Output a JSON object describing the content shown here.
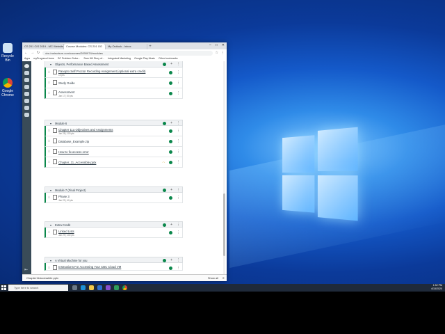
{
  "browser": {
    "tabs": [
      {
        "label": "CS 201 CIS 2019 - MC Website"
      },
      {
        "label": "Course Modules: CS 201 OO"
      },
      {
        "label": "My Outlook - Inbox"
      }
    ],
    "url": "cbc.instructure.com/courses/2090974/modules",
    "bookmarks": [
      "Apps",
      "myProgress Home",
      "SC Problem Solve...",
      "Sam Hill Story of...",
      "Integrated Marketing",
      "Google Play Music",
      "Other bookmarks"
    ],
    "download_file": "Chapter11Accessible.pptx",
    "show_all": "Show all"
  },
  "modules": [
    {
      "title": "Objects, Performance Based Assessment",
      "items": [
        {
          "name": "Panopto Self Proctor Recording Assignment (optional extra credit)",
          "meta": "10 pts",
          "underline": true
        },
        {
          "name": "Study Guide",
          "meta": "",
          "underline": false
        },
        {
          "name": "Assessment",
          "meta": "Jan 17  |  50 pts",
          "underline": false
        }
      ]
    },
    {
      "title": "Module 6",
      "items": [
        {
          "name": "Chapter 11a Objectives and Assignments",
          "meta": "Jan 28  |  100 pts",
          "underline": true
        },
        {
          "name": "Database_Example.zip",
          "meta": "",
          "underline": false
        },
        {
          "name": "How to fix access error",
          "meta": "",
          "underline": true
        },
        {
          "name": "Chapter_11_Accessible.pptx",
          "meta": "",
          "underline": true
        }
      ]
    },
    {
      "title": "Module 7 (Final Project)",
      "items": [
        {
          "name": "Phase 3",
          "meta": "Jan 29  |  40 pts",
          "underline": false
        }
      ]
    },
    {
      "title": "Extra Credit",
      "items": [
        {
          "name": "Linked Lists",
          "meta": "Jan 29  |  100 pts",
          "underline": true
        }
      ]
    },
    {
      "title": "A Virtual Machine for you",
      "items": [
        {
          "name": "Instructions For Accessing Your CBC Cloud VM",
          "meta": "",
          "underline": true
        }
      ]
    }
  ],
  "taskbar": {
    "search_placeholder": "Type here to search",
    "time": "1:52 PM",
    "date": "4/15/2020"
  },
  "desktop": {
    "icons": [
      "Recycle Bin",
      "Google Chrome"
    ]
  }
}
